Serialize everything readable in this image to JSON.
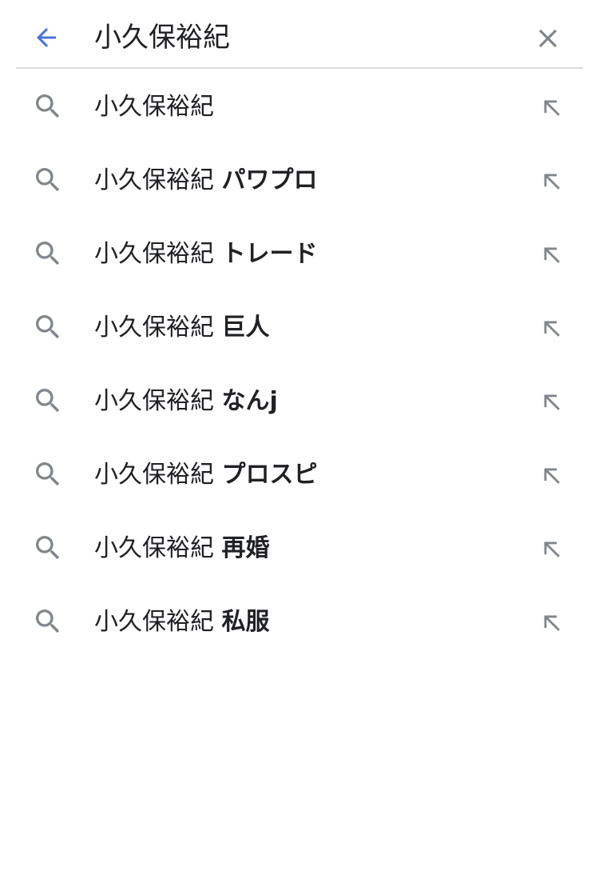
{
  "search": {
    "query": "小久保裕紀"
  },
  "icons": {
    "back": "arrow-left-icon",
    "clear": "close-icon",
    "suggestion": "search-icon",
    "fill": "arrow-up-left-icon"
  },
  "colors": {
    "back_arrow": "#4a72d9",
    "icon_gray": "#80868b",
    "divider": "#dadce0",
    "text": "#202124"
  },
  "suggestions": [
    {
      "base": "小久保裕紀",
      "bold": ""
    },
    {
      "base": "小久保裕紀",
      "bold": "パワプロ"
    },
    {
      "base": "小久保裕紀",
      "bold": "トレード"
    },
    {
      "base": "小久保裕紀",
      "bold": "巨人"
    },
    {
      "base": "小久保裕紀",
      "bold": "なんj"
    },
    {
      "base": "小久保裕紀",
      "bold": "プロスピ"
    },
    {
      "base": "小久保裕紀",
      "bold": "再婚"
    },
    {
      "base": "小久保裕紀",
      "bold": "私服"
    }
  ]
}
